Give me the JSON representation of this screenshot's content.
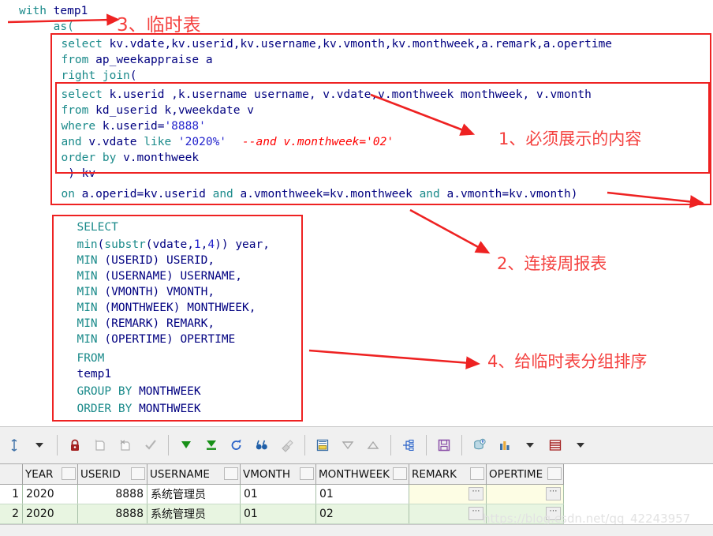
{
  "editor": {
    "lines": [
      {
        "id": "l1",
        "text": "with temp1"
      },
      {
        "id": "l2",
        "text": "     as("
      },
      {
        "id": "l3",
        "text": "  select kv.vdate,kv.userid,kv.username,kv.vmonth,kv.monthweek,a.remark,a.opertime"
      },
      {
        "id": "l4",
        "text": "  from ap_weekappraise a"
      },
      {
        "id": "l5",
        "text": "  right join("
      },
      {
        "id": "l6",
        "text": "  select k.userid ,k.username username, v.vdate,v.monthweek monthweek, v.vmonth"
      },
      {
        "id": "l7",
        "text": "  from kd_userid k,vweekdate v"
      },
      {
        "id": "l8",
        "text": "  where k.userid='8888'"
      },
      {
        "id": "l9",
        "text": "  and v.vdate like '2020%'"
      },
      {
        "id": "l9c",
        "text": "--and v.monthweek='02'"
      },
      {
        "id": "l10",
        "text": "  order by v.monthweek"
      },
      {
        "id": "l11",
        "text": "   ) kv"
      },
      {
        "id": "l12",
        "text": "  on a.operid=kv.userid and a.vmonthweek=kv.monthweek and a.vmonth=kv.vmonth)"
      },
      {
        "id": "l13",
        "text": "  SELECT"
      },
      {
        "id": "l14",
        "text": "  min(substr(vdate,1,4)) year,"
      },
      {
        "id": "l15",
        "text": "  MIN (USERID) USERID,"
      },
      {
        "id": "l16",
        "text": "  MIN (USERNAME) USERNAME,"
      },
      {
        "id": "l17",
        "text": "  MIN (VMONTH) VMONTH,"
      },
      {
        "id": "l18",
        "text": "  MIN (MONTHWEEK) MONTHWEEK,"
      },
      {
        "id": "l19",
        "text": "  MIN (REMARK) REMARK,"
      },
      {
        "id": "l20",
        "text": "  MIN (OPERTIME) OPERTIME"
      },
      {
        "id": "l21",
        "text": "  FROM"
      },
      {
        "id": "l22",
        "text": "  temp1"
      },
      {
        "id": "l23",
        "text": "  GROUP BY MONTHWEEK"
      },
      {
        "id": "l24",
        "text": "  ORDER BY MONTHWEEK"
      }
    ],
    "annotations": [
      {
        "id": "a3",
        "label": "3、临时表"
      },
      {
        "id": "a1",
        "label": "1、必须展示的内容"
      },
      {
        "id": "a2",
        "label": "2、连接周报表"
      },
      {
        "id": "a4",
        "label": "4、给临时表分组排序"
      }
    ],
    "annotation_color": "#f4413f"
  },
  "toolbar": {
    "items": [
      {
        "name": "commit-scope-icon",
        "glyph": "⇕",
        "color": "#3a6ea5"
      },
      {
        "name": "dropdown-caret-1",
        "glyph": "▾",
        "color": "#333333"
      },
      {
        "name": "lock-icon",
        "glyph": "🔒",
        "color": "#a32020"
      },
      {
        "name": "new-record-icon",
        "glyph": "▭",
        "color": "#9aa0a6"
      },
      {
        "name": "delete-record-icon",
        "glyph": "▭",
        "color": "#9aa0a6"
      },
      {
        "name": "post-edit-icon",
        "glyph": "✔",
        "color": "#9aa0a6"
      },
      {
        "name": "fetch-next-icon",
        "glyph": "▼",
        "color": "#189018"
      },
      {
        "name": "fetch-all-icon",
        "glyph": "▼",
        "color": "#189018"
      },
      {
        "name": "refresh-icon",
        "glyph": "↻",
        "color": "#2a62c8"
      },
      {
        "name": "find-icon",
        "glyph": "🔍",
        "color": "#1f5fa8"
      },
      {
        "name": "clear-filter-icon",
        "glyph": "◧",
        "color": "#b8b8b8"
      },
      {
        "name": "single-record-icon",
        "glyph": "▤",
        "color": "#3a6ea5"
      },
      {
        "name": "sort-desc-icon",
        "glyph": "▽",
        "color": "#9aa0a6"
      },
      {
        "name": "sort-asc-icon",
        "glyph": "△",
        "color": "#9aa0a6"
      },
      {
        "name": "explain-plan-icon",
        "glyph": "⑆",
        "color": "#2a62c8"
      },
      {
        "name": "save-icon",
        "glyph": "💾",
        "color": "#8a4fa8"
      },
      {
        "name": "export-data-icon",
        "glyph": "⛁",
        "color": "#4c8fa8"
      },
      {
        "name": "chart-icon",
        "glyph": "📊",
        "color": "#3a6ea5"
      },
      {
        "name": "chart-caret",
        "glyph": "▾",
        "color": "#333333"
      },
      {
        "name": "grid-icon",
        "glyph": "▤",
        "color": "#a32020"
      },
      {
        "name": "grid-caret",
        "glyph": "▾",
        "color": "#333333"
      }
    ]
  },
  "results": {
    "columns": [
      "YEAR",
      "USERID",
      "USERNAME",
      "VMONTH",
      "MONTHWEEK",
      "REMARK",
      "OPERTIME"
    ],
    "rows": [
      {
        "num": "1",
        "YEAR": "2020",
        "USERID": "8888",
        "USERNAME": "系统管理员",
        "VMONTH": "01",
        "MONTHWEEK": "01",
        "REMARK": "",
        "OPERTIME": ""
      },
      {
        "num": "2",
        "YEAR": "2020",
        "USERID": "8888",
        "USERNAME": "系统管理员",
        "VMONTH": "01",
        "MONTHWEEK": "02",
        "REMARK": "",
        "OPERTIME": ""
      }
    ],
    "lob_button_label": "⋯"
  },
  "watermark": {
    "text": "https://blog.csdn.net/qq_42243957"
  }
}
